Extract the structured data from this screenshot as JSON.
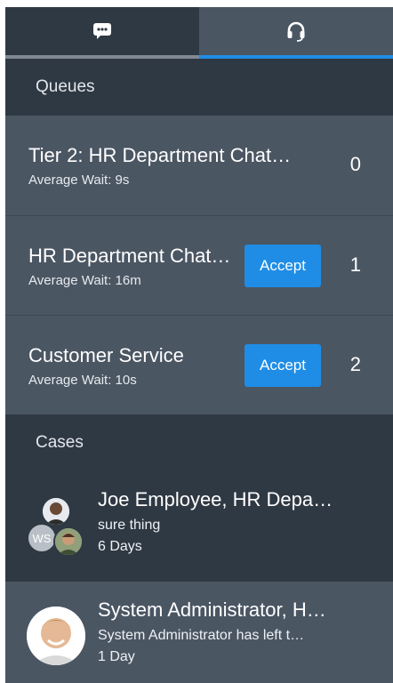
{
  "tabs": [
    {
      "name": "chat",
      "icon": "chat-bubble-icon",
      "active": false
    },
    {
      "name": "support",
      "icon": "headset-icon",
      "active": true
    }
  ],
  "queues": {
    "header": "Queues",
    "items": [
      {
        "name": "Tier 2: HR Department Chat …",
        "wait": "Average Wait: 9s",
        "count": "0",
        "has_accept": false
      },
      {
        "name": "HR Department Chat…",
        "wait": "Average Wait: 16m",
        "count": "1",
        "has_accept": true,
        "accept_label": "Accept"
      },
      {
        "name": "Customer Service",
        "wait": "Average Wait: 10s",
        "count": "2",
        "has_accept": true,
        "accept_label": "Accept"
      }
    ]
  },
  "cases": {
    "header": "Cases",
    "items": [
      {
        "title": "Joe Employee, HR Depa…",
        "subtitle": "sure thing",
        "time": "6 Days",
        "avatar_initials": "WS"
      },
      {
        "title": "System Administrator, H…",
        "subtitle": "System Administrator has left t…",
        "time": "1 Day"
      }
    ]
  },
  "colors": {
    "accent": "#1f8de6",
    "panel_dark": "#2f3944",
    "panel_light": "#4b5663"
  }
}
